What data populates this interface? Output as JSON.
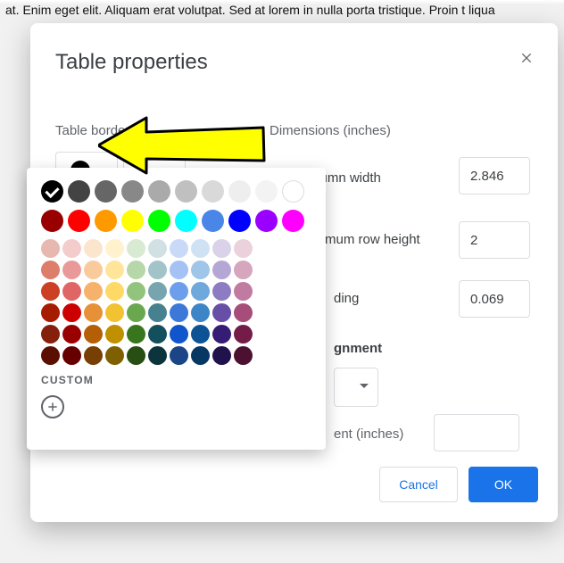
{
  "background_text": "at. Enim eget elit. Aliquam erat volutpat. Sed at lorem in nulla porta tristique. Proin t\nliqua",
  "dialog": {
    "title": "Table properties",
    "labels": {
      "table_border": "Table border",
      "dimensions": "Dimensions  (inches)",
      "column_width": "Column width",
      "min_row_height": "mum row height",
      "cell_padding": "ding",
      "alignment": "gnment",
      "indent": "ent  (inches)"
    },
    "values": {
      "column_width": "2.846",
      "min_row_height": "2",
      "cell_padding": "0.069",
      "column_width_checked": true
    },
    "border_color": "#000000",
    "buttons": {
      "cancel": "Cancel",
      "ok": "OK"
    }
  },
  "picker": {
    "custom_label": "CUSTOM",
    "selected": "#000000",
    "row_big": [
      "#000000",
      "#434343",
      "#666666",
      "#888888",
      "#aaaaaa",
      "#c0c0c0",
      "#d9d9d9",
      "#eeeeee",
      "#f3f3f3",
      "#ffffff"
    ],
    "row_sat": [
      "#980000",
      "#ff0000",
      "#ff9900",
      "#ffff00",
      "#00ff00",
      "#00ffff",
      "#4a86e8",
      "#0000ff",
      "#9900ff",
      "#ff00ff"
    ],
    "grid": [
      [
        "#e6b8af",
        "#f4cccc",
        "#fce5cd",
        "#fff2cc",
        "#d9ead3",
        "#d0e0e3",
        "#c9daf8",
        "#cfe2f3",
        "#d9d2e9",
        "#ead1dc"
      ],
      [
        "#dd7e6b",
        "#ea9999",
        "#f9cb9c",
        "#ffe599",
        "#b6d7a8",
        "#a2c4c9",
        "#a4c2f4",
        "#9fc5e8",
        "#b4a7d6",
        "#d5a6bd"
      ],
      [
        "#cc4125",
        "#e06666",
        "#f6b26b",
        "#ffd966",
        "#93c47d",
        "#76a5af",
        "#6d9eeb",
        "#6fa8dc",
        "#8e7cc3",
        "#c27ba0"
      ],
      [
        "#a61c00",
        "#cc0000",
        "#e69138",
        "#f1c232",
        "#6aa84f",
        "#45818e",
        "#3c78d8",
        "#3d85c6",
        "#674ea7",
        "#a64d79"
      ],
      [
        "#85200c",
        "#990000",
        "#b45f06",
        "#bf9000",
        "#38761d",
        "#134f5c",
        "#1155cc",
        "#0b5394",
        "#351c75",
        "#741b47"
      ],
      [
        "#5b0f00",
        "#660000",
        "#783f04",
        "#7f6000",
        "#274e13",
        "#0c343d",
        "#1c4587",
        "#073763",
        "#20124d",
        "#4c1130"
      ]
    ]
  }
}
